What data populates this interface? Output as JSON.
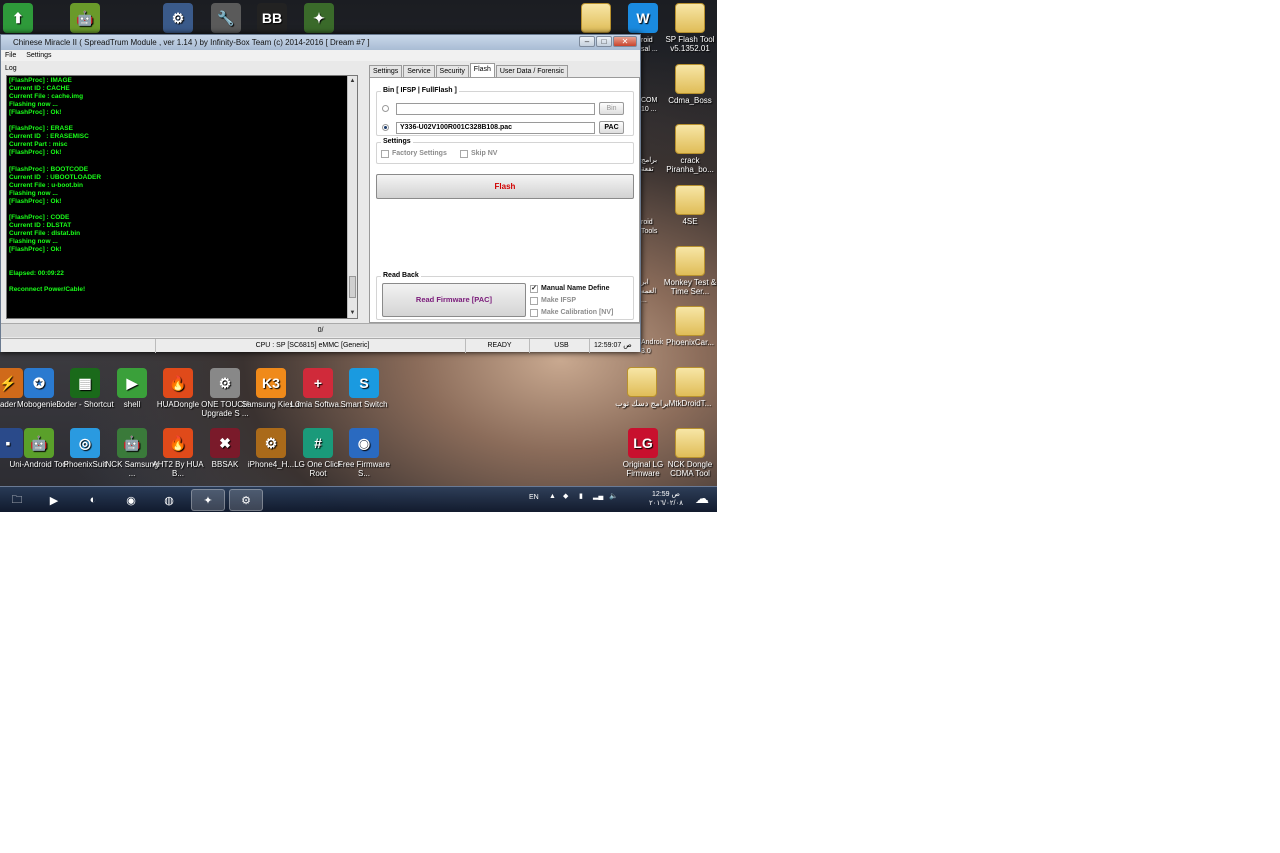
{
  "window": {
    "title": "Chinese Miracle II ( SpreadTrum Module , ver 1.14 ) by Infinity-Box Team (c) 2014-2016 [ Dream #7 ]",
    "ctl_min": "–",
    "ctl_max": "□",
    "ctl_close": "✕"
  },
  "menu": {
    "file": "File",
    "settings": "Settings"
  },
  "log": {
    "label": "Log",
    "text": "[FlashProc] : IMAGE\nCurrent ID : CACHE\nCurrent File : cache.img\nFlashing now ...\n[FlashProc] : Ok!\n\n[FlashProc] : ERASE\nCurrent ID   : ERASEMISC\nCurrent Part : misc\n[FlashProc] : Ok!\n\n[FlashProc] : BOOTCODE\nCurrent ID   : UBOOTLOADER\nCurrent File : u-boot.bin\nFlashing now ...\n[FlashProc] : Ok!\n\n[FlashProc] : CODE\nCurrent ID : DLSTAT\nCurrent File : dlstat.bin\nFlashing now ...\n[FlashProc] : Ok!\n\n\nElapsed: 00:09:22\n\nReconnect Power/Cable!"
  },
  "tabs": [
    "Settings",
    "Service",
    "Security",
    "Flash",
    "User Data / Forensic"
  ],
  "flash": {
    "bin_group": "Bin  [ IFSP | FullFlash ]",
    "bin_value": "",
    "bin_button": "Bin",
    "pac_value": "Y336-U02V100R001C328B108.pac",
    "pac_button": "PAC",
    "settings_group": "Settings",
    "factory_settings": "Factory Settings",
    "skip_nv": "Skip NV",
    "flash_button": "Flash",
    "readback_group": "Read Back",
    "read_firmware": "Read Firmware [PAC]",
    "manual_name": "Manual Name Define",
    "make_ifsp": "Make IFSP",
    "make_calibration": "Make Calibration [NV]",
    "check_mark": "✓"
  },
  "progress": {
    "text": "0/"
  },
  "status": {
    "cpu": "CPU : SP [SC6815] eMMC [Generic]",
    "state": "READY",
    "conn": "USB",
    "time": "12:59:07 ص"
  },
  "desktop_top": [
    {
      "label": "",
      "icon": "⬆",
      "color": "#2e9a3a"
    },
    {
      "label": "",
      "icon": "🤖",
      "color": "#6a9a2a"
    },
    {
      "label": "",
      "icon": "⚙",
      "color": "#3a5a8a"
    },
    {
      "label": "",
      "icon": "🔧",
      "color": "#5a5a5a"
    },
    {
      "label": "",
      "icon": "BB",
      "color": "#222"
    },
    {
      "label": "",
      "icon": "✦",
      "color": "#3a6a2a"
    }
  ],
  "desktop_right": [
    {
      "label": "",
      "icon": ""
    },
    {
      "label": "",
      "icon": "W"
    },
    {
      "label": "SP Flash Tool v5.1352.01",
      "icon": ""
    },
    {
      "label": "Cdma_Boss",
      "icon": ""
    },
    {
      "label": "crack Piranha_bo...",
      "icon": ""
    },
    {
      "label": "4SE",
      "icon": ""
    },
    {
      "label": "Monkey Test & Time Ser...",
      "icon": ""
    },
    {
      "label": "PhoenixCar...",
      "icon": ""
    },
    {
      "label": "برامج دسك توب",
      "icon": ""
    },
    {
      "label": "MtkDroidT...",
      "icon": ""
    },
    {
      "label": "Original LG Firmware",
      "icon": "LG"
    },
    {
      "label": "NCK Dongle CDMA Tool",
      "icon": ""
    }
  ],
  "desktop_row1": [
    {
      "label": "ader",
      "icon": "⚡"
    },
    {
      "label": "Mobogenie3",
      "icon": "✪"
    },
    {
      "label": "Loder - Shortcut",
      "icon": "▦"
    },
    {
      "label": "shell",
      "icon": "▶"
    },
    {
      "label": "HUADongle",
      "icon": "🔥"
    },
    {
      "label": "ONE TOUCH Upgrade S ...",
      "icon": "⚙"
    },
    {
      "label": "Samsung Kies 3",
      "icon": "K3"
    },
    {
      "label": "Lumia Softwa...",
      "icon": "+"
    },
    {
      "label": "Smart Switch",
      "icon": "S"
    }
  ],
  "desktop_row2": [
    {
      "label": "",
      "icon": "▪"
    },
    {
      "label": "Uni-Android Tool",
      "icon": "🤖"
    },
    {
      "label": "PhoenixSuit",
      "icon": "◎"
    },
    {
      "label": "NCK Samsung ...",
      "icon": "🤖"
    },
    {
      "label": "AHT2 By HUA B...",
      "icon": "🔥"
    },
    {
      "label": "BBSAK",
      "icon": "✖"
    },
    {
      "label": "iPhone4_H...",
      "icon": "⚙"
    },
    {
      "label": "LG One Click Root",
      "icon": "#"
    },
    {
      "label": "Free Firmware S...",
      "icon": "◉"
    }
  ],
  "partial_labels": [
    "roid sal ...",
    "COM 10 ...",
    "برامج تفعة",
    "roid Tools",
    "ابر العمه ...",
    "Android 3.0"
  ],
  "tray": {
    "lang": "EN",
    "time": "12:59 ص",
    "date": "٢٠١٦/٠٢/٠٨"
  }
}
